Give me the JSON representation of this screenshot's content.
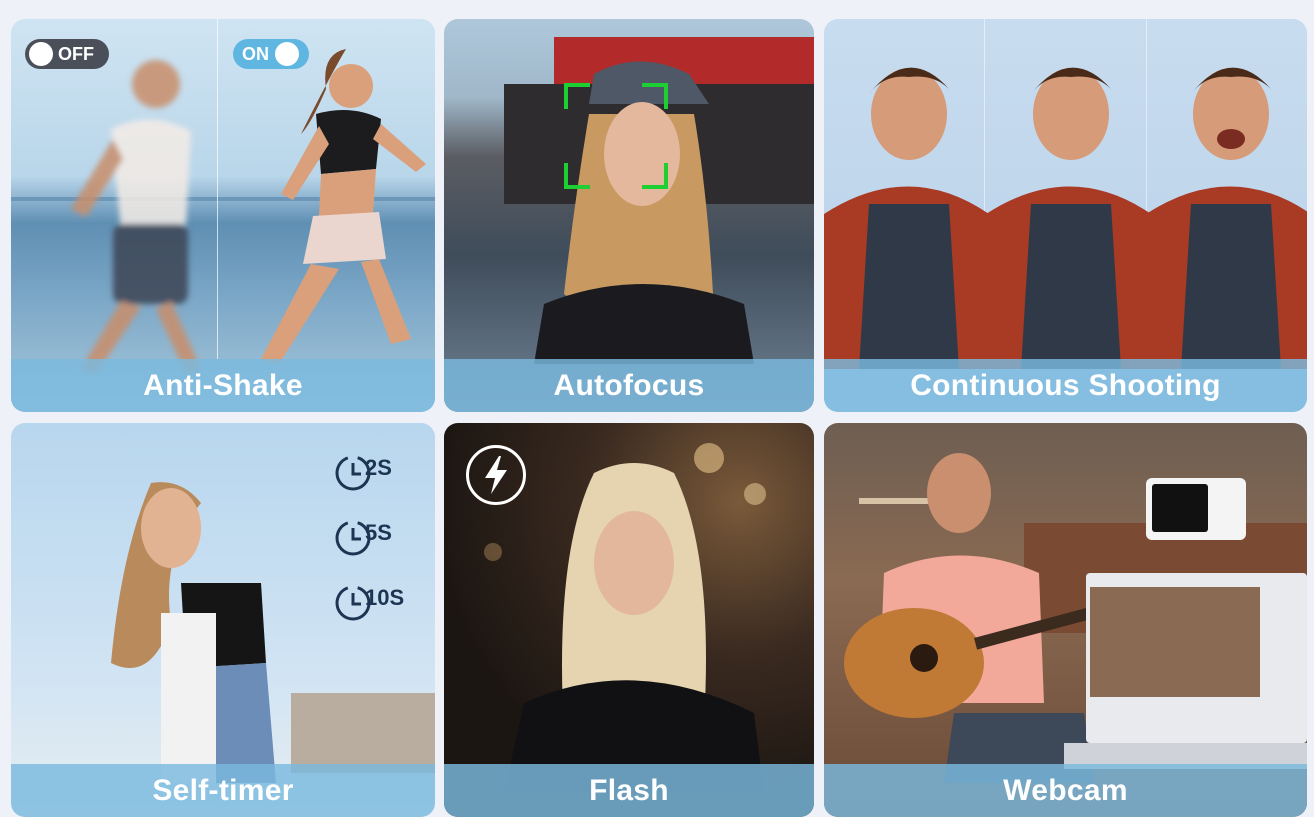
{
  "tiles": {
    "anti_shake": {
      "caption": "Anti-Shake",
      "toggle_off": "OFF",
      "toggle_on": "ON"
    },
    "autofocus": {
      "caption": "Autofocus"
    },
    "continuous": {
      "caption": "Continuous Shooting"
    },
    "self_timer": {
      "caption": "Self-timer",
      "timers": [
        "2S",
        "5S",
        "10S"
      ]
    },
    "flash": {
      "caption": "Flash"
    },
    "webcam": {
      "caption": "Webcam"
    }
  },
  "colors": {
    "caption_bar": "#7abade",
    "focus_frame": "#1ecf33",
    "toggle_on": "#5fb6e0",
    "toggle_off": "#4a4f59",
    "timer_icon": "#1d3552"
  },
  "icons": [
    "toggle-off-icon",
    "toggle-on-icon",
    "focus-frame-icon",
    "timer-2s-icon",
    "timer-5s-icon",
    "timer-10s-icon",
    "flash-bolt-icon"
  ]
}
